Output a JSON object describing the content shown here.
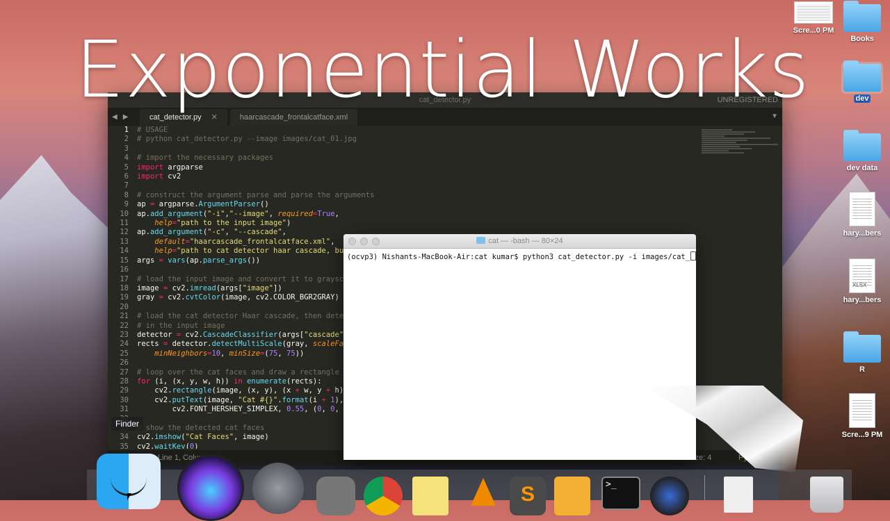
{
  "overlay_title": "Exponential Works",
  "editor": {
    "window_title": "cat_detector.py",
    "unregistered": "UNREGISTERED",
    "tabs": [
      {
        "label": "cat_detector.py",
        "active": true
      },
      {
        "label": "haarcascade_frontalcatface.xml",
        "active": false
      }
    ],
    "status": {
      "left": "Line 1, Column 1",
      "tab_size": "Tab Size: 4",
      "language": "Python"
    }
  },
  "terminal": {
    "title": "cat — -bash — 80×24",
    "prompt": "(ocvp3) Nishants-MacBook-Air:cat kumar$ python3 cat_detector.py -i images/cat_"
  },
  "tooltip": "Finder",
  "desktop_icons": [
    {
      "label": "Scre...0 PM",
      "kind": "screenshot"
    },
    {
      "label": "Books",
      "kind": "folder"
    },
    {
      "label": "dev",
      "kind": "folder-selected"
    },
    {
      "label": "dev data",
      "kind": "folder"
    },
    {
      "label": "hary...bers",
      "kind": "doc"
    },
    {
      "label": "hary...bers",
      "kind": "xlsx"
    },
    {
      "label": "R",
      "kind": "folder"
    },
    {
      "label": "Scre...9 PM",
      "kind": "doc"
    }
  ],
  "dock_icons": [
    "finder-icon",
    "siri-icon",
    "launchpad-icon",
    "system-preferences-icon",
    "chrome-icon",
    "notes-icon",
    "vlc-icon",
    "sublime-icon",
    "pages-icon",
    "terminal-icon",
    "quicktime-icon",
    "document-icon",
    "trash-icon"
  ],
  "xlsx_tag": "XLSX",
  "terminal_dock_text": ">_"
}
